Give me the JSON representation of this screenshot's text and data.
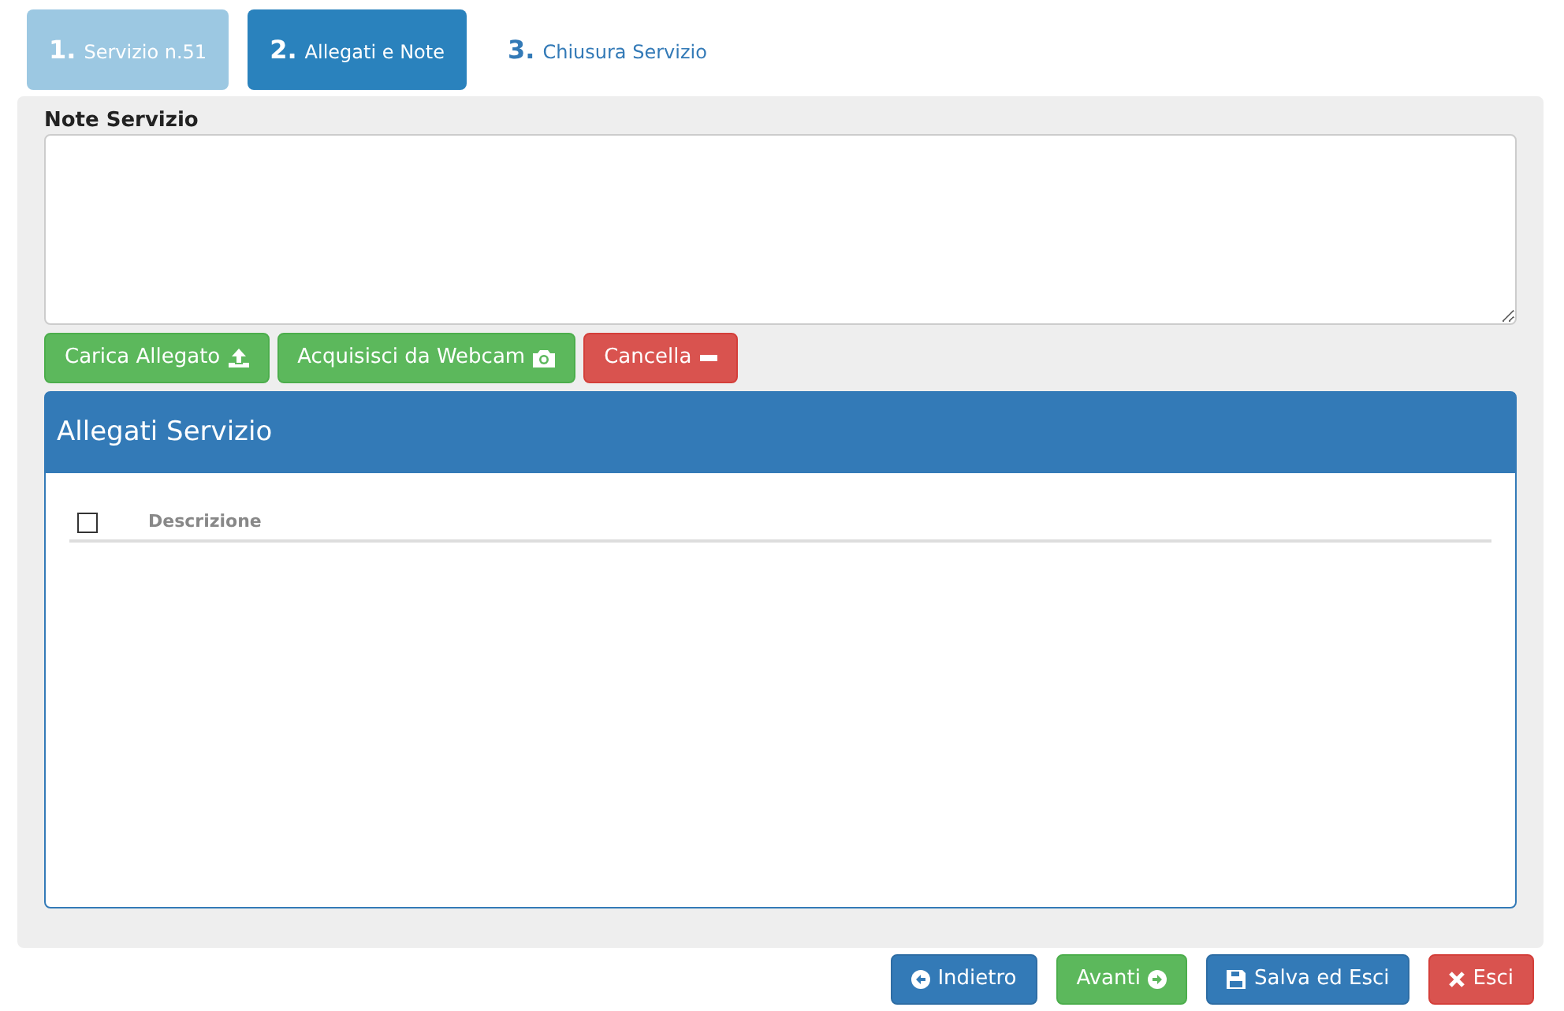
{
  "steps": [
    {
      "number": "1.",
      "label": "Servizio n.51",
      "selected": false,
      "done": true
    },
    {
      "number": "2.",
      "label": "Allegati e Note",
      "selected": true,
      "done": false
    },
    {
      "number": "3.",
      "label": "Chiusura Servizio",
      "selected": false,
      "done": false
    }
  ],
  "notes": {
    "label": "Note Servizio"
  },
  "actions": [
    {
      "label": "Carica Allegato",
      "kind": "success"
    },
    {
      "label": "Acquisisci da Webcam",
      "kind": "success"
    },
    {
      "label": "Cancella",
      "kind": "danger"
    }
  ],
  "attachments": {
    "title": "Allegati Servizio",
    "select_all_checked": false,
    "columns": [
      "Descrizione"
    ]
  },
  "footer_buttons": [
    {
      "label": "Indietro",
      "kind": "primary"
    },
    {
      "label": "Avanti",
      "kind": "success"
    },
    {
      "label": "Salva ed Esci",
      "kind": "primary"
    },
    {
      "label": "Esci",
      "kind": "danger"
    }
  ]
}
